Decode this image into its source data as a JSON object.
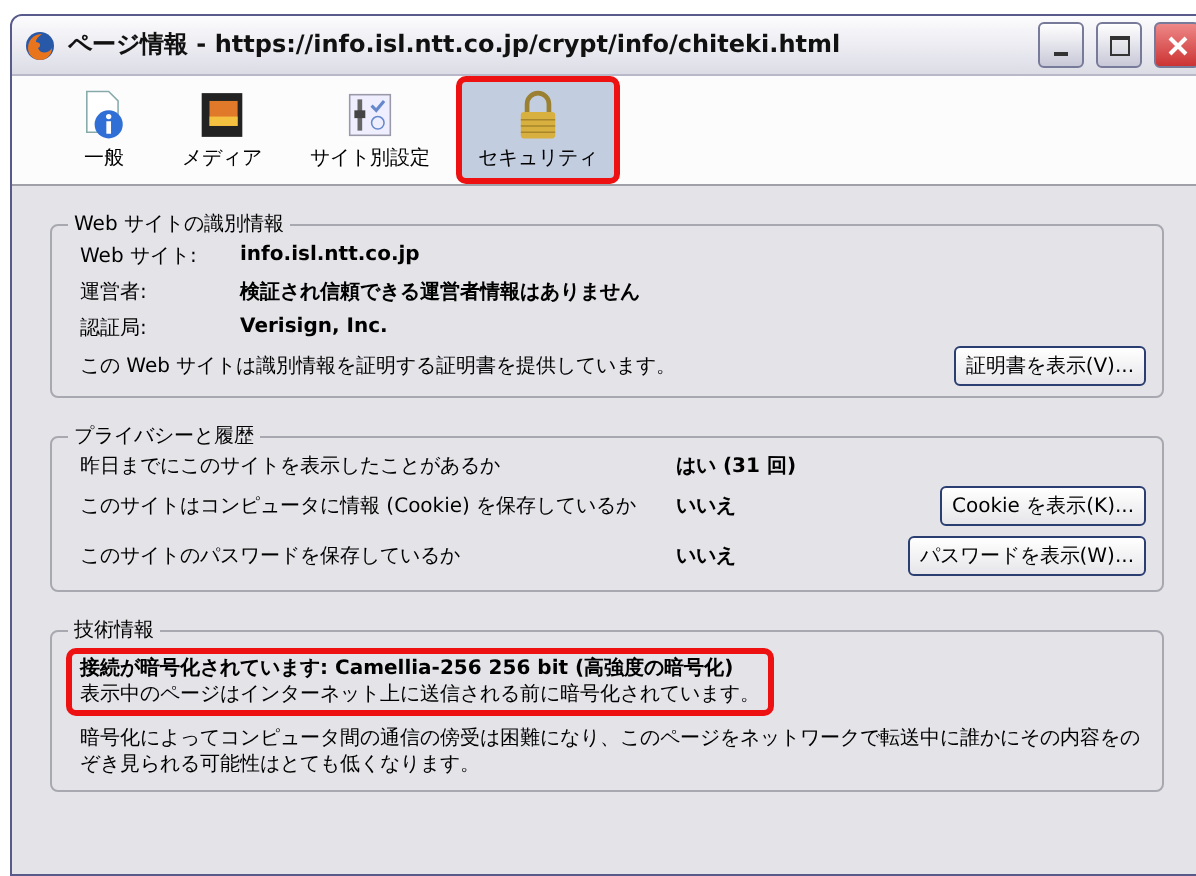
{
  "window": {
    "title": "ページ情報 - https://info.isl.ntt.co.jp/crypt/info/chiteki.html"
  },
  "tabs": [
    {
      "label": "一般",
      "kind": "general",
      "selected": false,
      "highlighted": false
    },
    {
      "label": "メディア",
      "kind": "media",
      "selected": false,
      "highlighted": false
    },
    {
      "label": "サイト別設定",
      "kind": "permissions",
      "selected": false,
      "highlighted": false
    },
    {
      "label": "セキュリティ",
      "kind": "security",
      "selected": true,
      "highlighted": true
    }
  ],
  "identity": {
    "legend": "Web サイトの識別情報",
    "fields": [
      {
        "label": "Web サイト:",
        "value": "info.isl.ntt.co.jp"
      },
      {
        "label": "運営者:",
        "value": "検証され信頼できる運営者情報はありません"
      },
      {
        "label": "認証局:",
        "value": "Verisign, Inc."
      }
    ],
    "note": "この Web サイトは識別情報を証明する証明書を提供しています。",
    "button": "証明書を表示(V)..."
  },
  "privacy": {
    "legend": "プライバシーと履歴",
    "rows": [
      {
        "question": "昨日までにこのサイトを表示したことがあるか",
        "answer": "はい (31 回)"
      },
      {
        "question": "このサイトはコンピュータに情報 (Cookie) を保存しているか",
        "answer": "いいえ",
        "button": "Cookie を表示(K)..."
      },
      {
        "question": "このサイトのパスワードを保存しているか",
        "answer": "いいえ",
        "button": "パスワードを表示(W)..."
      }
    ]
  },
  "technical": {
    "legend": "技術情報",
    "headline": "接続が暗号化されています: Camellia-256 256 bit (高強度の暗号化)",
    "highlighted": true,
    "line": "表示中のページはインターネット上に送信される前に暗号化されています。",
    "paragraph": "暗号化によってコンピュータ間の通信の傍受は困難になり、このページをネットワークで転送中に誰かにその内容をのぞき見られる可能性はとても低くなります。"
  }
}
